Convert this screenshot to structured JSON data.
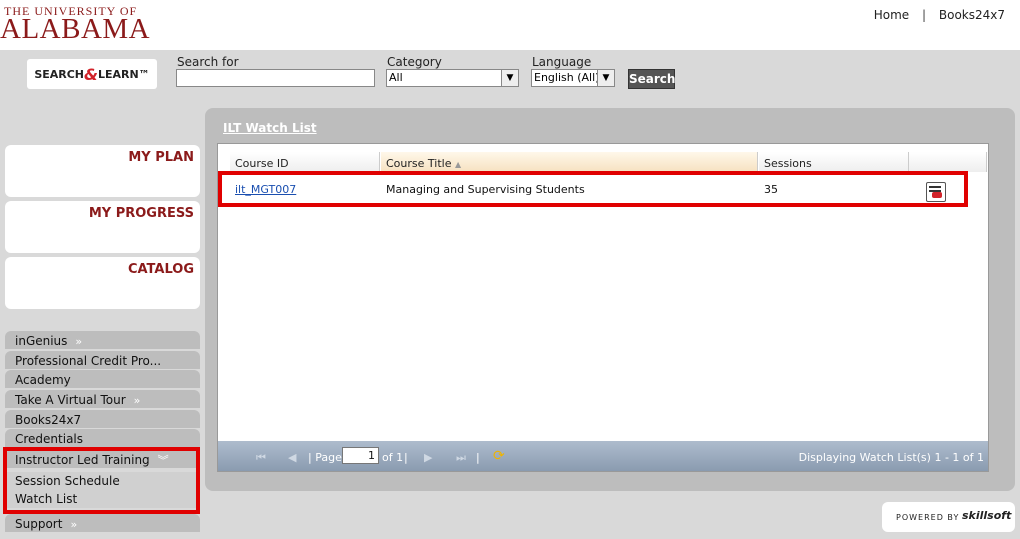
{
  "header": {
    "logo_small": "THE UNIVERSITY OF",
    "logo_big": "ALABAMA",
    "links": [
      "Home",
      "Books24x7"
    ]
  },
  "search": {
    "logo_left": "SEARCH",
    "logo_amp": "&",
    "logo_right": "LEARN™",
    "search_for_label": "Search for",
    "search_value": "",
    "category_label": "Category",
    "category_value": "All",
    "language_label": "Language",
    "language_value": "English (All)",
    "button": "Search"
  },
  "sidebar": {
    "boxes": [
      "MY PLAN",
      "MY PROGRESS",
      "CATALOG"
    ],
    "items": [
      "inGenius",
      "Professional Credit Pro...",
      "Academy",
      "Take A Virtual Tour",
      "Books24x7",
      "Credentials",
      "Instructor Led Training"
    ],
    "subitems": [
      "Session Schedule",
      "Watch List"
    ],
    "support": "Support"
  },
  "panel": {
    "title": "ILT Watch List",
    "columns": [
      "Course ID",
      "Course Title",
      "Sessions"
    ],
    "rows": [
      {
        "id": "ilt_MGT007",
        "title": "Managing and Supervising Students",
        "sessions": "35"
      }
    ],
    "pager": {
      "page_label": "Page",
      "page_value": "1",
      "of_label": "of 1",
      "display": "Displaying Watch List(s) 1 - 1 of 1"
    }
  },
  "footer": {
    "powered_by": "POWERED BY",
    "brand": "skillsoft"
  },
  "colors": {
    "brand": "#8b1a1a",
    "highlight": "#e00000"
  }
}
